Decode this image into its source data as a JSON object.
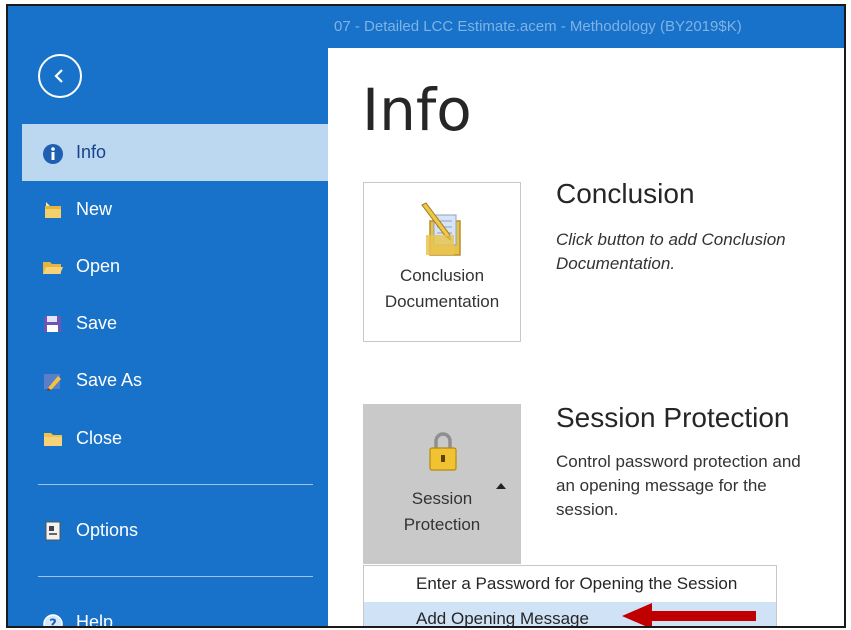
{
  "window": {
    "title": "07 - Detailed LCC Estimate.acem - Methodology (BY2019$K)"
  },
  "sidebar": {
    "back_icon": "back-arrow-icon",
    "items": [
      {
        "label": "Info",
        "icon": "info-icon",
        "active": true
      },
      {
        "label": "New",
        "icon": "new-icon"
      },
      {
        "label": "Open",
        "icon": "folder-open-icon"
      },
      {
        "label": "Save",
        "icon": "save-icon"
      },
      {
        "label": "Save As",
        "icon": "save-as-icon"
      },
      {
        "label": "Close",
        "icon": "folder-close-icon"
      },
      {
        "label": "Options",
        "icon": "options-icon"
      },
      {
        "label": "Help",
        "icon": "help-icon"
      }
    ]
  },
  "main": {
    "title": "Info",
    "conclusion": {
      "tile_line1": "Conclusion",
      "tile_line2": "Documentation",
      "title": "Conclusion",
      "desc_line1": "Click button to add Conclusion",
      "desc_line2": "Documentation."
    },
    "session": {
      "tile_line1": "Session",
      "tile_line2": "Protection",
      "title": "Session Protection",
      "desc_line1": "Control password protection and",
      "desc_line2": "an opening message for the",
      "desc_line3": "session."
    },
    "menu": {
      "items": [
        {
          "label": "Enter a Password for Opening the Session"
        },
        {
          "label": "Add Opening Message",
          "highlighted": true
        }
      ]
    }
  },
  "colors": {
    "sidebar": "#1872c9",
    "active_item": "#bcd8f1",
    "arrow": "#c00000"
  }
}
